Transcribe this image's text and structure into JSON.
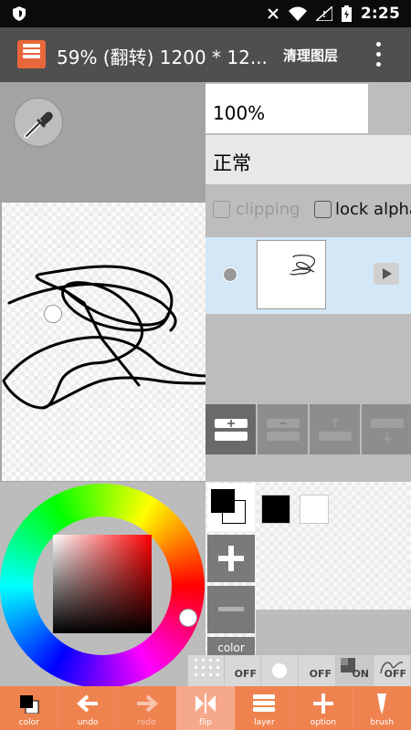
{
  "status_bar": {
    "time": "2:25"
  },
  "app_bar": {
    "title": "59% (翻转) 1200 * 12...",
    "clean_button": "清理图层"
  },
  "layer_panel": {
    "opacity": "100%",
    "blend_mode": "正常",
    "clipping_label": "clipping",
    "lock_alpha_label": "lock alpha"
  },
  "color_panel": {
    "color_label": "color"
  },
  "toggle_bar": {
    "items": [
      {
        "label": "OFF"
      },
      {
        "label": "OFF"
      },
      {
        "label": "ON"
      },
      {
        "label": "OFF"
      }
    ]
  },
  "bottom_bar": {
    "items": [
      {
        "label": "color"
      },
      {
        "label": "undo"
      },
      {
        "label": "redo"
      },
      {
        "label": "flip"
      },
      {
        "label": "layer"
      },
      {
        "label": "option"
      },
      {
        "label": "brush"
      }
    ]
  },
  "colors": {
    "accent": "#ef8350",
    "appbar": "#4f4f4f",
    "layer_selected": "#d3e7f6",
    "swatch_1": "#000000",
    "swatch_2": "#ffffff"
  }
}
